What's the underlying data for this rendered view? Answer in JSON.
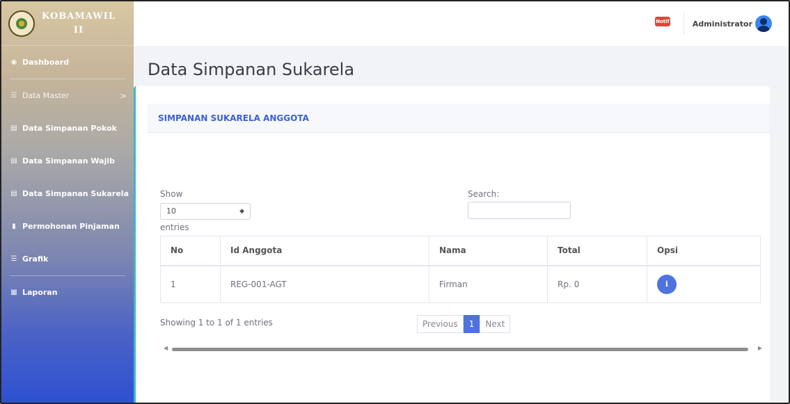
{
  "brand": {
    "line1": "KOBAMAWIL",
    "line2": "II"
  },
  "sidebar": {
    "items": [
      {
        "label": "Dashboard",
        "icon": "gauge-icon"
      },
      {
        "label": "Data Master",
        "icon": "list-icon",
        "chevron": ">"
      },
      {
        "label": "Data Simpanan Pokok",
        "icon": "book-icon"
      },
      {
        "label": "Data Simpanan Wajib",
        "icon": "book-icon"
      },
      {
        "label": "Data Simpanan Sukarela",
        "icon": "book-icon"
      },
      {
        "label": "Permohonan Pinjaman",
        "icon": "file-icon"
      },
      {
        "label": "Grafik",
        "icon": "list-icon"
      },
      {
        "label": "Laporan",
        "icon": "report-icon"
      }
    ]
  },
  "topbar": {
    "notif_label": "Notif",
    "user_name": "Administrator"
  },
  "page": {
    "title": "Data Simpanan Sukarela"
  },
  "card": {
    "header": "SIMPANAN SUKARELA ANGGOTA"
  },
  "datatable": {
    "show_label": "Show",
    "entries_select_value": "10",
    "entries_label": "entries",
    "search_label": "Search:",
    "search_value": "",
    "columns": [
      "No",
      "Id Anggota",
      "Nama",
      "Total",
      "Opsi"
    ],
    "rows": [
      {
        "no": "1",
        "id_anggota": "REG-001-AGT",
        "nama": "Firman",
        "total": "Rp. 0",
        "opsi_icon": "info-icon"
      }
    ],
    "info": "Showing 1 to 1 of 1 entries",
    "pagination": {
      "previous": "Previous",
      "current": "1",
      "next": "Next"
    }
  },
  "colors": {
    "accent": "#4e73df",
    "card_border": "#36b9cc",
    "header_text": "#3c61d2"
  }
}
